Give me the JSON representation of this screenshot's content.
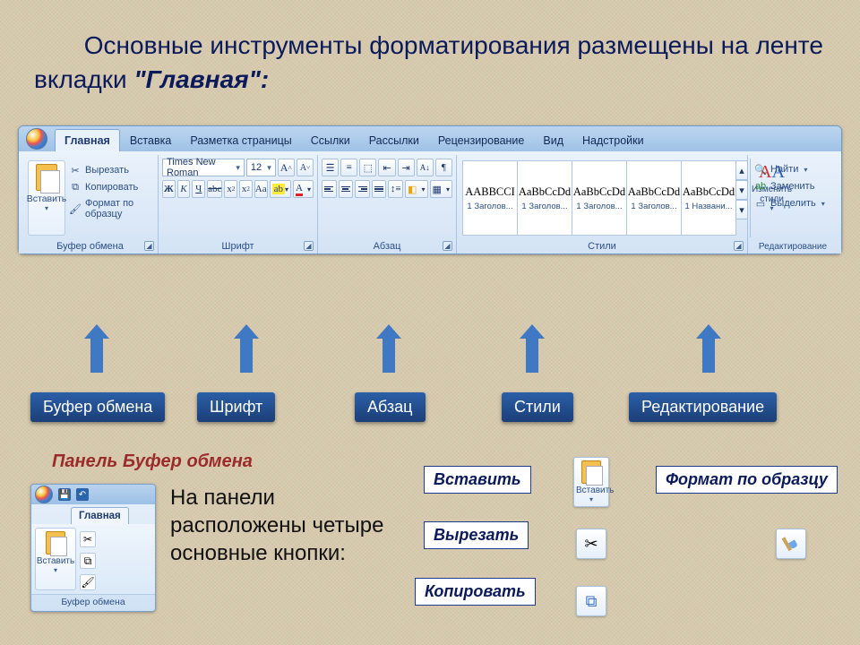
{
  "heading": {
    "line1_prefix": "Основные инструменты форматирования размещены на ленте вкладки ",
    "emphasis": "\"Главная\":"
  },
  "ribbon": {
    "tabs": [
      "Главная",
      "Вставка",
      "Разметка страницы",
      "Ссылки",
      "Рассылки",
      "Рецензирование",
      "Вид",
      "Надстройки"
    ],
    "clipboard": {
      "paste": "Вставить",
      "cut": "Вырезать",
      "copy": "Копировать",
      "format_painter": "Формат по образцу",
      "label": "Буфер обмена"
    },
    "font": {
      "name": "Times New Roman",
      "size": "12",
      "label": "Шрифт"
    },
    "paragraph": {
      "label": "Абзац"
    },
    "styles": {
      "label": "Стили",
      "change": "Изменить стили",
      "items": [
        {
          "sample": "AABBCCI",
          "name": "1 Заголов..."
        },
        {
          "sample": "AaBbCcDd",
          "name": "1 Заголов..."
        },
        {
          "sample": "AaBbCcDd",
          "name": "1 Заголов..."
        },
        {
          "sample": "AaBbCcDd",
          "name": "1 Заголов..."
        },
        {
          "sample": "AaBbCcDd",
          "name": "1 Названи..."
        }
      ]
    },
    "editing": {
      "label": "Редактирование",
      "find": "Найти",
      "replace": "Заменить",
      "select": "Выделить"
    }
  },
  "callouts": [
    "Буфер обмена",
    "Шрифт",
    "Абзац",
    "Стили",
    "Редактирование"
  ],
  "panel_section": {
    "title": "Панель Буфер обмена",
    "text": "На панели расположены четыре основные кнопки:"
  },
  "mini_panel": {
    "tab": "Главная",
    "paste": "Вставить",
    "footer": "Буфер обмена"
  },
  "actions": {
    "paste": "Вставить",
    "cut": "Вырезать",
    "copy": "Копировать",
    "format_painter": "Формат по образцу"
  }
}
